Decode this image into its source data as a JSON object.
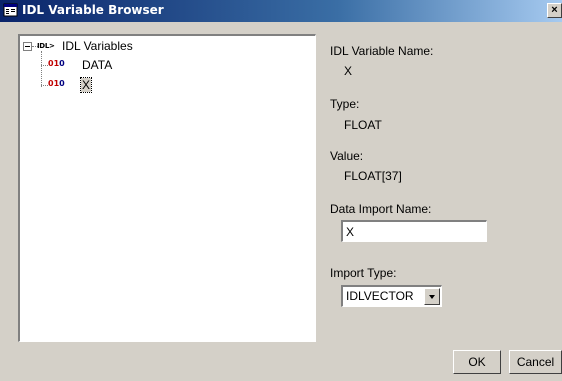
{
  "window": {
    "title": "IDL Variable Browser",
    "close_label": "×"
  },
  "tree": {
    "root_icon_text": "IDL>",
    "root_label": "IDL Variables",
    "items": [
      {
        "icon_a": "01",
        "icon_b": "0",
        "label": "DATA"
      },
      {
        "icon_a": "01",
        "icon_b": "0",
        "label": "X"
      }
    ]
  },
  "details": {
    "name_label": "IDL Variable Name:",
    "name_value": "X",
    "type_label": "Type:",
    "type_value": "FLOAT",
    "value_label": "Value:",
    "value_value": "FLOAT[37]",
    "import_name_label": "Data Import Name:",
    "import_name_value": "X",
    "import_type_label": "Import Type:",
    "import_type_value": "IDLVECTOR"
  },
  "buttons": {
    "ok": "OK",
    "cancel": "Cancel"
  }
}
